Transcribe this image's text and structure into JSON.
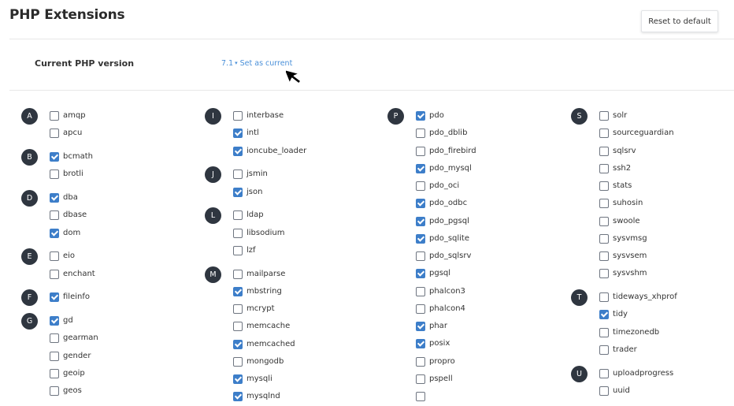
{
  "header": {
    "title": "PHP Extensions",
    "reset_label": "Reset to default"
  },
  "version": {
    "label": "Current PHP version",
    "value": "7.1",
    "caret": "▾",
    "set_current_label": "Set as current"
  },
  "colors": {
    "accent": "#3d7ec9",
    "link": "#4a90d9",
    "letter_badge": "#2f3640"
  },
  "extension_columns": [
    [
      {
        "letter": "A",
        "items": [
          {
            "name": "amqp",
            "checked": false
          },
          {
            "name": "apcu",
            "checked": false
          }
        ]
      },
      {
        "letter": "B",
        "items": [
          {
            "name": "bcmath",
            "checked": true
          },
          {
            "name": "brotli",
            "checked": false
          }
        ]
      },
      {
        "letter": "D",
        "items": [
          {
            "name": "dba",
            "checked": true
          },
          {
            "name": "dbase",
            "checked": false
          },
          {
            "name": "dom",
            "checked": true
          }
        ]
      },
      {
        "letter": "E",
        "items": [
          {
            "name": "eio",
            "checked": false
          },
          {
            "name": "enchant",
            "checked": false
          }
        ]
      },
      {
        "letter": "F",
        "items": [
          {
            "name": "fileinfo",
            "checked": true
          }
        ]
      },
      {
        "letter": "G",
        "items": [
          {
            "name": "gd",
            "checked": true
          },
          {
            "name": "gearman",
            "checked": false
          },
          {
            "name": "gender",
            "checked": false
          },
          {
            "name": "geoip",
            "checked": false
          },
          {
            "name": "geos",
            "checked": false
          }
        ]
      }
    ],
    [
      {
        "letter": "I",
        "items": [
          {
            "name": "interbase",
            "checked": false
          },
          {
            "name": "intl",
            "checked": true
          },
          {
            "name": "ioncube_loader",
            "checked": true
          }
        ]
      },
      {
        "letter": "J",
        "items": [
          {
            "name": "jsmin",
            "checked": false
          },
          {
            "name": "json",
            "checked": true
          }
        ]
      },
      {
        "letter": "L",
        "items": [
          {
            "name": "ldap",
            "checked": false
          },
          {
            "name": "libsodium",
            "checked": false
          },
          {
            "name": "lzf",
            "checked": false
          }
        ]
      },
      {
        "letter": "M",
        "items": [
          {
            "name": "mailparse",
            "checked": false
          },
          {
            "name": "mbstring",
            "checked": true
          },
          {
            "name": "mcrypt",
            "checked": false
          },
          {
            "name": "memcache",
            "checked": false
          },
          {
            "name": "memcached",
            "checked": true
          },
          {
            "name": "mongodb",
            "checked": false
          },
          {
            "name": "mysqli",
            "checked": true
          },
          {
            "name": "mysqlnd",
            "checked": true
          }
        ]
      }
    ],
    [
      {
        "letter": "P",
        "items": [
          {
            "name": "pdo",
            "checked": true
          },
          {
            "name": "pdo_dblib",
            "checked": false
          },
          {
            "name": "pdo_firebird",
            "checked": false
          },
          {
            "name": "pdo_mysql",
            "checked": true
          },
          {
            "name": "pdo_oci",
            "checked": false
          },
          {
            "name": "pdo_odbc",
            "checked": true
          },
          {
            "name": "pdo_pgsql",
            "checked": true
          },
          {
            "name": "pdo_sqlite",
            "checked": true
          },
          {
            "name": "pdo_sqlsrv",
            "checked": false
          },
          {
            "name": "pgsql",
            "checked": true
          },
          {
            "name": "phalcon3",
            "checked": false
          },
          {
            "name": "phalcon4",
            "checked": false
          },
          {
            "name": "phar",
            "checked": true
          },
          {
            "name": "posix",
            "checked": true
          },
          {
            "name": "propro",
            "checked": false
          },
          {
            "name": "pspell",
            "checked": false
          },
          {
            "name": "",
            "checked": false
          }
        ]
      }
    ],
    [
      {
        "letter": "S",
        "items": [
          {
            "name": "solr",
            "checked": false
          },
          {
            "name": "sourceguardian",
            "checked": false
          },
          {
            "name": "sqlsrv",
            "checked": false
          },
          {
            "name": "ssh2",
            "checked": false
          },
          {
            "name": "stats",
            "checked": false
          },
          {
            "name": "suhosin",
            "checked": false
          },
          {
            "name": "swoole",
            "checked": false
          },
          {
            "name": "sysvmsg",
            "checked": false
          },
          {
            "name": "sysvsem",
            "checked": false
          },
          {
            "name": "sysvshm",
            "checked": false
          }
        ]
      },
      {
        "letter": "T",
        "items": [
          {
            "name": "tideways_xhprof",
            "checked": false
          },
          {
            "name": "tidy",
            "checked": true
          },
          {
            "name": "timezonedb",
            "checked": false
          },
          {
            "name": "trader",
            "checked": false
          }
        ]
      },
      {
        "letter": "U",
        "items": [
          {
            "name": "uploadprogress",
            "checked": false
          },
          {
            "name": "uuid",
            "checked": false
          }
        ]
      }
    ]
  ]
}
